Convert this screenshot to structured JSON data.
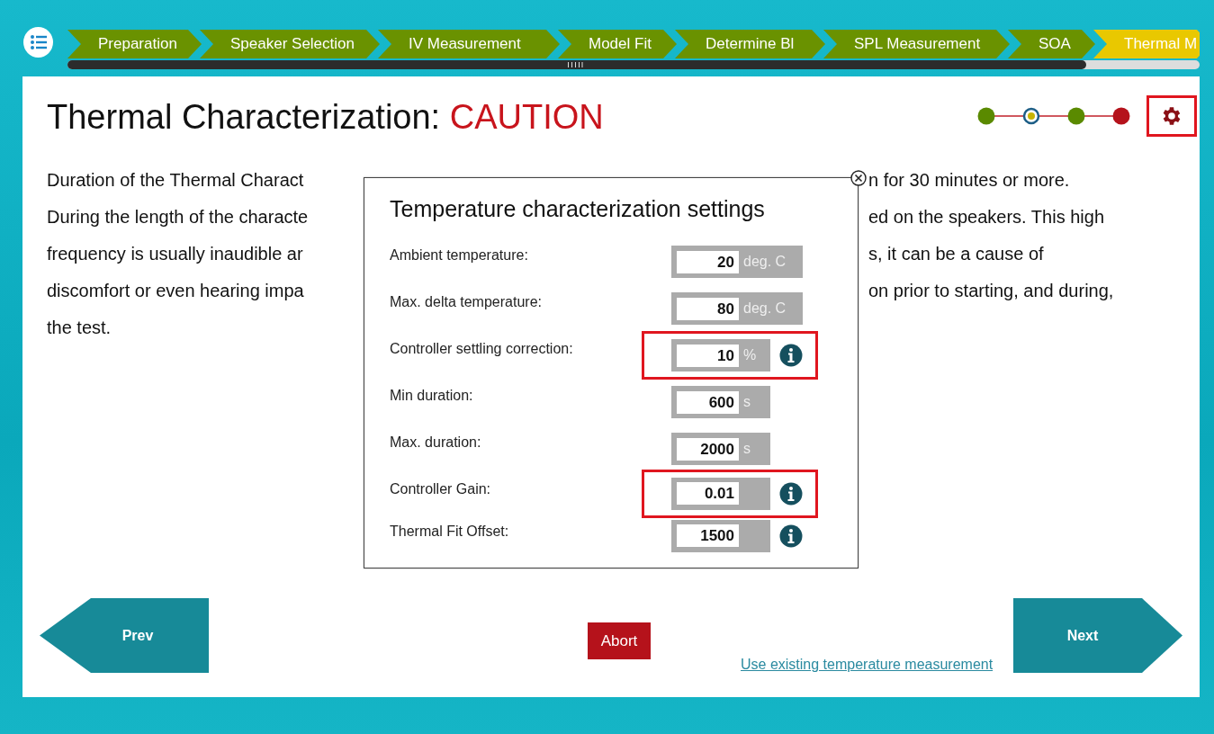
{
  "steps": [
    {
      "label": "Preparation",
      "selected": false
    },
    {
      "label": "Speaker Selection",
      "selected": false
    },
    {
      "label": "IV Measurement",
      "selected": false
    },
    {
      "label": "Model Fit",
      "selected": false
    },
    {
      "label": "Determine Bl",
      "selected": false
    },
    {
      "label": "SPL Measurement",
      "selected": false
    },
    {
      "label": "SOA",
      "selected": false
    },
    {
      "label": "Thermal M",
      "selected": true
    }
  ],
  "progress": {
    "level": 0.9
  },
  "title": {
    "text": "Thermal Characterization:",
    "warning": "CAUTION"
  },
  "stage_dots": [
    {
      "color": "#5a8a00",
      "selected": false
    },
    {
      "color": "#c8b400",
      "selected": true
    },
    {
      "color": "#5a8a00",
      "selected": false
    },
    {
      "color": "#b5121b",
      "selected": false
    }
  ],
  "settings_button": {
    "highlighted": true
  },
  "paragraph_lines": [
    {
      "left": "Duration of the Thermal Charact",
      "right": "n for 30 minutes or more."
    },
    {
      "left": "During the length of the characte",
      "right": "ed on the speakers. This high"
    },
    {
      "left": "frequency is usually inaudible ar",
      "right": "s, it can be a cause of"
    },
    {
      "left": "discomfort or even hearing impa",
      "right": "on prior to starting, and during,"
    },
    {
      "left": "the test."
    }
  ],
  "dialog": {
    "title": "Temperature characterization settings",
    "fields": [
      {
        "label": "Ambient temperature:",
        "value": "20",
        "unit": "deg. C",
        "info": false,
        "highlighted": false
      },
      {
        "label": "Max. delta temperature:",
        "value": "80",
        "unit": "deg. C",
        "info": false,
        "highlighted": false
      },
      {
        "label": "Controller settling correction:",
        "value": "10",
        "unit": "%",
        "info": true,
        "highlighted": true
      },
      {
        "label": "Min duration:",
        "value": "600",
        "unit": "s",
        "info": false,
        "highlighted": false
      },
      {
        "label": "Max. duration:",
        "value": "2000",
        "unit": "s",
        "info": false,
        "highlighted": false
      },
      {
        "label": "Controller Gain:",
        "value": "0.01",
        "info": true,
        "highlighted": true
      },
      {
        "label": "Thermal Fit Offset:",
        "value": "1500",
        "info": true,
        "highlighted": false
      }
    ]
  },
  "buttons": {
    "prev": "Prev",
    "abort": "Abort",
    "next": "Next"
  },
  "link": "Use existing temperature measurement"
}
